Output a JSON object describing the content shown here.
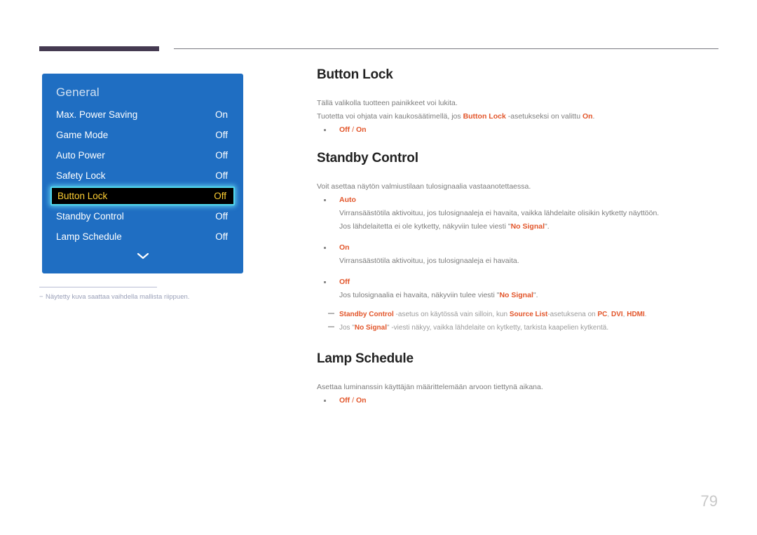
{
  "colors": {
    "accent_rule": "#453a51",
    "osd_panel_bg": "#1f6ec2",
    "osd_selected_bg": "#000000",
    "osd_selected_text": "#ffcf33",
    "osd_selected_border": "#4fd8ee",
    "emphasis": "#e2552a",
    "body_text": "#7c7c7c",
    "page_number": "#c8c8c8"
  },
  "osd": {
    "title": "General",
    "more_icon": "chevron-down-icon",
    "rows": [
      {
        "label": "Max. Power Saving",
        "value": "On",
        "selected": false
      },
      {
        "label": "Game Mode",
        "value": "Off",
        "selected": false
      },
      {
        "label": "Auto Power",
        "value": "Off",
        "selected": false
      },
      {
        "label": "Safety Lock",
        "value": "Off",
        "selected": false
      },
      {
        "label": "Button Lock",
        "value": "Off",
        "selected": true
      },
      {
        "label": "Standby Control",
        "value": "Off",
        "selected": false
      },
      {
        "label": "Lamp Schedule",
        "value": "Off",
        "selected": false
      }
    ],
    "footnote": "Näytetty kuva saattaa vaihdella mallista riippuen."
  },
  "sections": {
    "button_lock": {
      "title": "Button Lock",
      "p1": "Tällä valikolla tuotteen painikkeet voi lukita.",
      "p2_a": "Tuotetta voi ohjata vain kaukosäätimellä, jos ",
      "p2_em1": "Button Lock",
      "p2_b": " -asetukseksi on valittu ",
      "p2_em2": "On",
      "p2_c": ".",
      "option_off": "Off",
      "option_sep": " / ",
      "option_on": "On"
    },
    "standby_control": {
      "title": "Standby Control",
      "p1": "Voit asettaa näytön valmiustilaan tulosignaalia vastaanotettaessa.",
      "b1_head": "Auto",
      "b1_l1": "Virransäästötila aktivoituu, jos tulosignaaleja ei havaita, vaikka lähdelaite olisikin kytketty näyttöön.",
      "b1_l2_a": "Jos lähdelaitetta ei ole kytketty, näkyviin tulee viesti \"",
      "b1_l2_em": "No Signal",
      "b1_l2_b": "\".",
      "b2_head": "On",
      "b2_l1": "Virransäästötila aktivoituu, jos tulosignaaleja ei havaita.",
      "b3_head": "Off",
      "b3_l1_a": "Jos tulosignaalia ei havaita, näkyviin tulee viesti \"",
      "b3_l1_em": "No Signal",
      "b3_l1_b": "\".",
      "note1_em1": "Standby Control",
      "note1_a": " -asetus on käytössä vain silloin, kun ",
      "note1_em2": "Source List",
      "note1_b": "-asetuksena on ",
      "note1_em3": "PC",
      "note1_c": ", ",
      "note1_em4": "DVI",
      "note1_d": ", ",
      "note1_em5": "HDMI",
      "note1_e": ".",
      "note2_a": "Jos \"",
      "note2_em": "No Signal",
      "note2_b": "\" -viesti näkyy, vaikka lähdelaite on kytketty, tarkista kaapelien kytkentä."
    },
    "lamp_schedule": {
      "title": "Lamp Schedule",
      "p1": "Asettaa luminanssin käyttäjän määrittelemään arvoon tiettynä aikana.",
      "option_off": "Off",
      "option_sep": " / ",
      "option_on": "On"
    }
  },
  "page_number": "79"
}
